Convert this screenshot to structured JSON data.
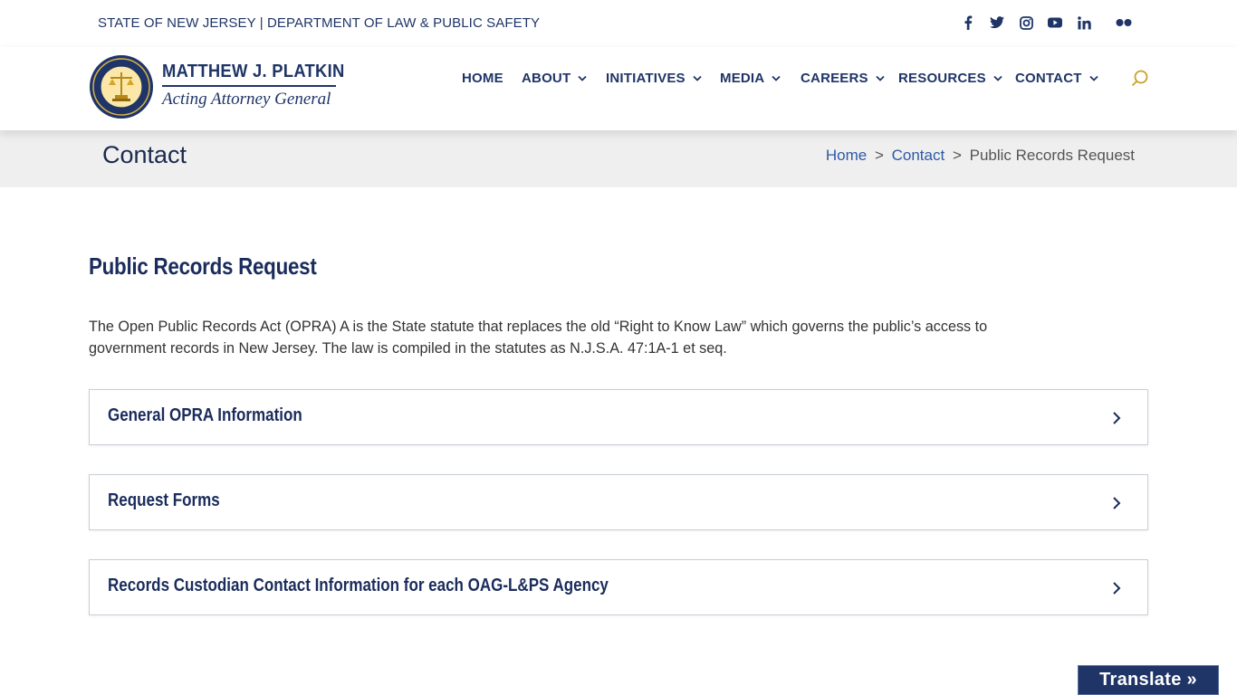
{
  "topbar": {
    "state_line": "STATE OF NEW JERSEY | DEPARTMENT OF LAW & PUBLIC SAFETY",
    "socials": [
      "facebook-icon",
      "twitter-icon",
      "instagram-icon",
      "youtube-icon",
      "linkedin-icon",
      "flickr-icon"
    ]
  },
  "logo": {
    "name": "MATTHEW J. PLATKIN",
    "subtitle": "Acting Attorney General"
  },
  "nav": {
    "items": [
      {
        "label": "HOME",
        "has_dropdown": false
      },
      {
        "label": "ABOUT",
        "has_dropdown": true
      },
      {
        "label": "INITIATIVES",
        "has_dropdown": true
      },
      {
        "label": "MEDIA",
        "has_dropdown": true
      },
      {
        "label": "CAREERS",
        "has_dropdown": true
      },
      {
        "label": "RESOURCES",
        "has_dropdown": true
      },
      {
        "label": "CONTACT",
        "has_dropdown": true
      }
    ],
    "search_icon": "search-icon"
  },
  "band": {
    "title": "Contact",
    "breadcrumb": {
      "home": "Home",
      "sep": ">",
      "section": "Contact",
      "current": "Public Records Request"
    }
  },
  "main": {
    "heading": "Public Records Request",
    "intro": "The Open Public Records Act (OPRA) A is the State statute that replaces the old “Right to Know Law” which governs the public’s access to government records in New Jersey. The law is compiled in the statutes as N.J.S.A. 47:1A-1 et seq.",
    "accordions": [
      {
        "label": "General OPRA Information"
      },
      {
        "label": "Request Forms"
      },
      {
        "label": "Records Custodian Contact Information for each OAG-L&PS Agency"
      }
    ]
  },
  "translate": {
    "label": "Translate »"
  },
  "colors": {
    "navy": "#1f3567",
    "link_blue": "#2d5aa8",
    "search_gold": "#c9a227",
    "band_gray": "#efefef"
  }
}
